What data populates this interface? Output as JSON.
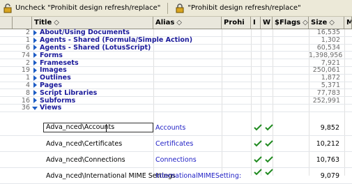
{
  "toolbar": {
    "uncheck_label": "Uncheck \"Prohibit design refresh/replace\"",
    "check_label": "\"Prohibit design refresh/replace\""
  },
  "columns": {
    "title": "Title",
    "alias": "Alias",
    "prohibit": "Prohi",
    "col_i": "I",
    "col_w": "W",
    "flags": "$Flags",
    "size": "Size",
    "more": "M",
    "sort_glyph": "◇"
  },
  "categories": [
    {
      "count": "2",
      "label": "About/Using Documents",
      "size": "16,535",
      "expanded": false
    },
    {
      "count": "1",
      "label": "Agents - Shared (Formula/Simple Action)",
      "size": "1,302",
      "expanded": false
    },
    {
      "count": "6",
      "label": "Agents - Shared (LotusScript)",
      "size": "60,534",
      "expanded": false
    },
    {
      "count": "74",
      "label": "Forms",
      "size": "1,398,956",
      "expanded": false
    },
    {
      "count": "2",
      "label": "Framesets",
      "size": "7,921",
      "expanded": false
    },
    {
      "count": "19",
      "label": "Images",
      "size": "250,061",
      "expanded": false
    },
    {
      "count": "1",
      "label": "Outlines",
      "size": "1,872",
      "expanded": false
    },
    {
      "count": "4",
      "label": "Pages",
      "size": "5,371",
      "expanded": false
    },
    {
      "count": "8",
      "label": "Script Libraries",
      "size": "77,783",
      "expanded": false
    },
    {
      "count": "16",
      "label": "Subforms",
      "size": "252,991",
      "expanded": false
    },
    {
      "count": "36",
      "label": "Views",
      "size": "",
      "expanded": true
    }
  ],
  "documents": [
    {
      "title": "Adva_nced\\Accounts",
      "alias": "Accounts",
      "size": "9,852",
      "editing": true
    },
    {
      "title": "Adva_nced\\Certificates",
      "alias": "Certificates",
      "size": "10,212",
      "editing": false
    },
    {
      "title": "Adva_nced\\Connections",
      "alias": "Connections",
      "size": "10,763",
      "editing": false
    },
    {
      "title": "Adva_nced\\International MIME Settings",
      "alias": "InternationalMIMESetting:",
      "size": "9,079",
      "editing": false
    }
  ],
  "colors": {
    "category_text": "#1a1a9a",
    "alias_link": "#1c1cc4",
    "twisty": "#1c5bc4",
    "check": "#1f8a1f"
  }
}
